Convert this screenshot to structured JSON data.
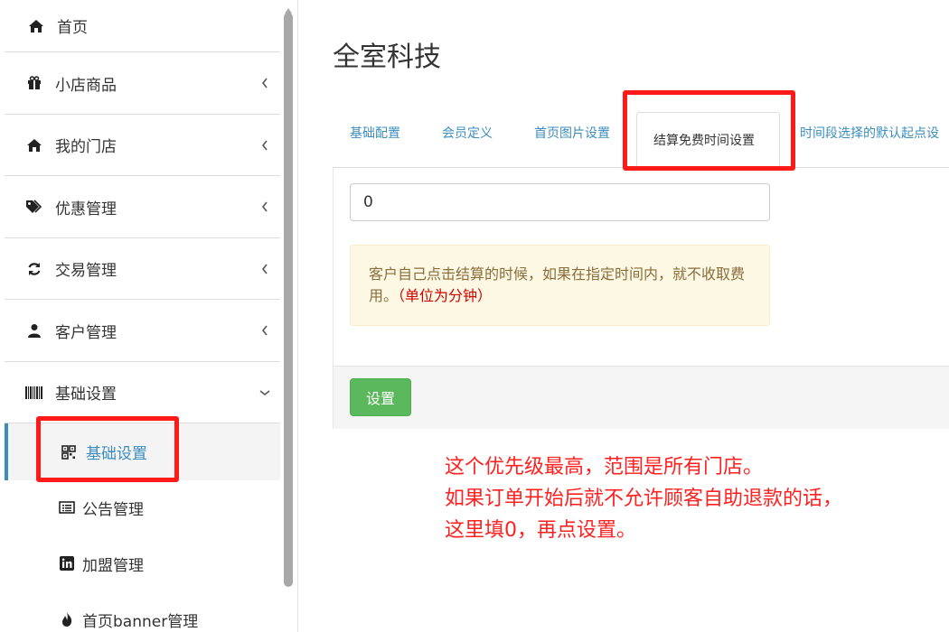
{
  "sidebar": {
    "items": [
      {
        "label": "首页",
        "icon": "home-icon",
        "has_chevron": false
      },
      {
        "label": "小店商品",
        "icon": "gift-icon",
        "has_chevron": true
      },
      {
        "label": "我的门店",
        "icon": "home-icon",
        "has_chevron": true
      },
      {
        "label": "优惠管理",
        "icon": "tags-icon",
        "has_chevron": true
      },
      {
        "label": "交易管理",
        "icon": "refresh-icon",
        "has_chevron": true
      },
      {
        "label": "客户管理",
        "icon": "user-icon",
        "has_chevron": true
      },
      {
        "label": "基础设置",
        "icon": "barcode-icon",
        "expanded": true
      }
    ],
    "sub_items": [
      {
        "label": "基础设置",
        "icon": "qrcode-icon",
        "active": true
      },
      {
        "label": "公告管理",
        "icon": "list-alt-icon"
      },
      {
        "label": "加盟管理",
        "icon": "linkedin-icon"
      },
      {
        "label": "首页banner管理",
        "icon": "fire-icon"
      }
    ]
  },
  "main": {
    "title": "全室科技",
    "tabs": [
      {
        "label": "基础配置",
        "active": false
      },
      {
        "label": "会员定义",
        "active": false
      },
      {
        "label": "首页图片设置",
        "active": false
      },
      {
        "label": "结算免费时间设置",
        "active": true
      },
      {
        "label": "时间段选择的默认起点设",
        "active": false
      }
    ],
    "input_value": "0",
    "notice_text": "客户自己点击结算的时候，如果在指定时间内，就不收取费用。",
    "notice_highlight": "（单位为分钟）",
    "submit_label": "设置"
  },
  "annotation": {
    "lines": [
      "这个优先级最高，范围是所有门店。",
      "如果订单开始后就不允许顾客自助退款的话，",
      "这里填0，再点设置。"
    ]
  },
  "colors": {
    "accent": "#3c8dbc",
    "success": "#5cb85c",
    "warning_bg": "#fcf8e3",
    "annotation_red": "#ff1a1a"
  }
}
